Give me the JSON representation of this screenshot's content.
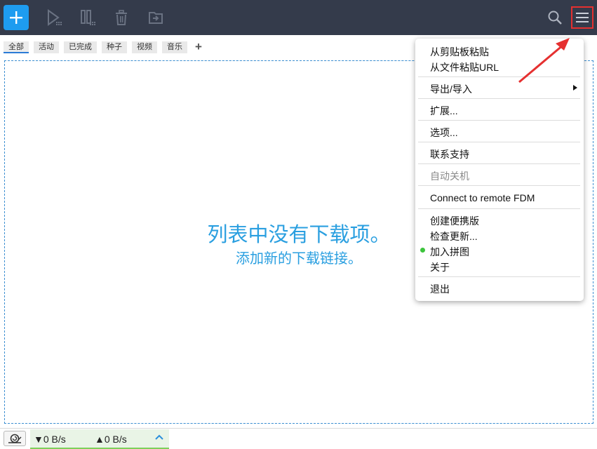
{
  "toolbar": {
    "buttons": [
      "add-download",
      "resume",
      "pause",
      "delete",
      "move"
    ]
  },
  "tabs": [
    {
      "label": "全部",
      "active": true
    },
    {
      "label": "活动"
    },
    {
      "label": "已完成"
    },
    {
      "label": "种子"
    },
    {
      "label": "视频"
    },
    {
      "label": "音乐"
    }
  ],
  "tabs_add_label": "+",
  "empty_state": {
    "title": "列表中没有下载项。",
    "subtitle": "添加新的下载链接。"
  },
  "status": {
    "download_speed": "▼0 B/s",
    "upload_speed": "▲0 B/s"
  },
  "menu": {
    "paste_clipboard": "从剪贴板粘贴",
    "paste_file_url": "从文件粘贴URL",
    "export_import": "导出/导入",
    "extensions": "扩展...",
    "options": "选项...",
    "contact_support": "联系支持",
    "auto_shutdown": "自动关机",
    "connect_remote": "Connect to remote FDM",
    "create_portable": "创建便携版",
    "check_updates": "检查更新...",
    "join_pintu": "加入拼图",
    "about": "关于",
    "quit": "退出"
  },
  "colors": {
    "toolbar_bg": "#343b4b",
    "accent": "#1e9cf0",
    "empty_text": "#2a9fe0",
    "highlight_red": "#e53030",
    "status_green": "#7ed05a"
  }
}
